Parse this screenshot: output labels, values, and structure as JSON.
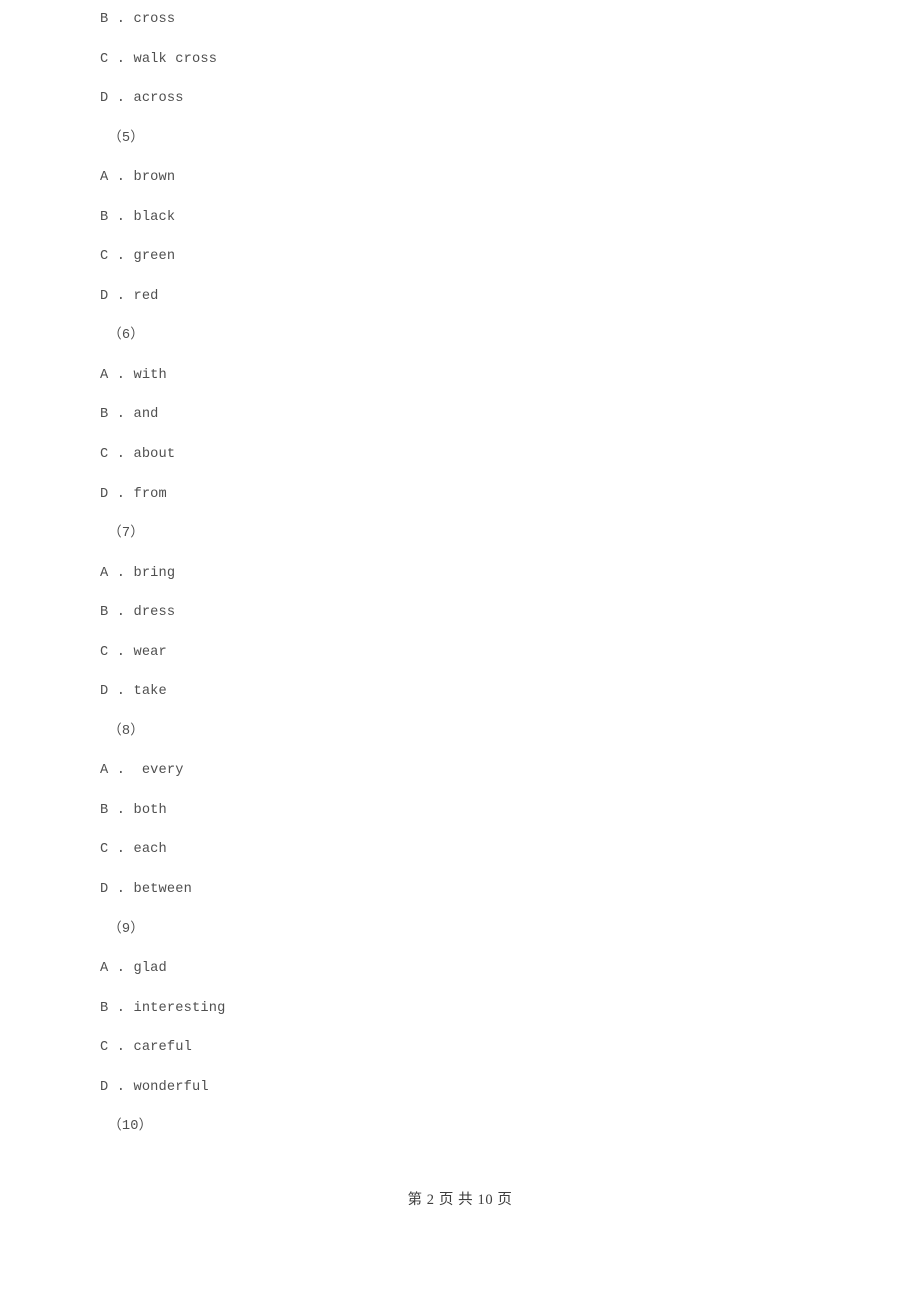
{
  "document": {
    "page_background": "#ffffff",
    "text_color": "#4f4f4f",
    "lines": [
      {
        "id": "opt-4-b",
        "type": "option",
        "text": "B . cross"
      },
      {
        "id": "opt-4-c",
        "type": "option",
        "text": "C . walk cross"
      },
      {
        "id": "opt-4-d",
        "type": "option",
        "text": "D . across"
      },
      {
        "id": "q-5",
        "type": "question",
        "text": "（5）"
      },
      {
        "id": "opt-5-a",
        "type": "option",
        "text": "A . brown"
      },
      {
        "id": "opt-5-b",
        "type": "option",
        "text": "B . black"
      },
      {
        "id": "opt-5-c",
        "type": "option",
        "text": "C . green"
      },
      {
        "id": "opt-5-d",
        "type": "option",
        "text": "D . red"
      },
      {
        "id": "q-6",
        "type": "question",
        "text": "（6）"
      },
      {
        "id": "opt-6-a",
        "type": "option",
        "text": "A . with"
      },
      {
        "id": "opt-6-b",
        "type": "option",
        "text": "B . and"
      },
      {
        "id": "opt-6-c",
        "type": "option",
        "text": "C . about"
      },
      {
        "id": "opt-6-d",
        "type": "option",
        "text": "D . from"
      },
      {
        "id": "q-7",
        "type": "question",
        "text": "（7）"
      },
      {
        "id": "opt-7-a",
        "type": "option",
        "text": "A . bring"
      },
      {
        "id": "opt-7-b",
        "type": "option",
        "text": "B . dress"
      },
      {
        "id": "opt-7-c",
        "type": "option",
        "text": "C . wear"
      },
      {
        "id": "opt-7-d",
        "type": "option",
        "text": "D . take"
      },
      {
        "id": "q-8",
        "type": "question",
        "text": "（8）"
      },
      {
        "id": "opt-8-a",
        "type": "option",
        "text": "A .  every"
      },
      {
        "id": "opt-8-b",
        "type": "option",
        "text": "B . both"
      },
      {
        "id": "opt-8-c",
        "type": "option",
        "text": "C . each"
      },
      {
        "id": "opt-8-d",
        "type": "option",
        "text": "D . between"
      },
      {
        "id": "q-9",
        "type": "question",
        "text": "（9）"
      },
      {
        "id": "opt-9-a",
        "type": "option",
        "text": "A . glad"
      },
      {
        "id": "opt-9-b",
        "type": "option",
        "text": "B . interesting"
      },
      {
        "id": "opt-9-c",
        "type": "option",
        "text": "C . careful"
      },
      {
        "id": "opt-9-d",
        "type": "option",
        "text": "D . wonderful"
      },
      {
        "id": "q-10",
        "type": "question",
        "text": "（10）"
      }
    ]
  },
  "footer": {
    "page_indicator": "第 2 页 共 10 页",
    "current_page": "2",
    "total_pages": "10"
  }
}
